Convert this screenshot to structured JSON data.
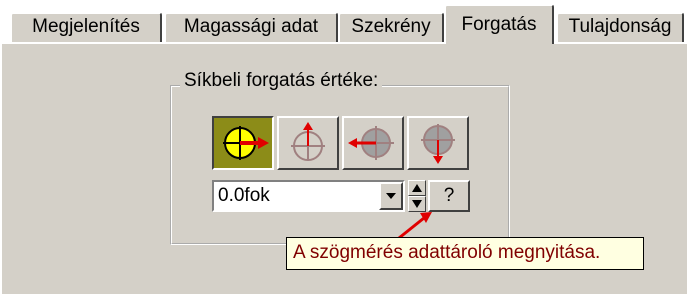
{
  "tabs": [
    {
      "label": "Megjelenítés",
      "active": false
    },
    {
      "label": "Magassági adat",
      "active": false
    },
    {
      "label": "Szekrény",
      "active": false
    },
    {
      "label": "Forgatás",
      "active": true
    },
    {
      "label": "Tulajdonság",
      "active": false
    }
  ],
  "group": {
    "label": "Síkbeli forgatás értéke:"
  },
  "rotation_buttons": [
    {
      "name": "rotate-right",
      "selected": true
    },
    {
      "name": "rotate-up",
      "selected": false
    },
    {
      "name": "rotate-left",
      "selected": false
    },
    {
      "name": "rotate-down",
      "selected": false
    }
  ],
  "angle_combo": {
    "value": "0.0fok"
  },
  "help_button": {
    "label": "?"
  },
  "tooltip": {
    "text": "A szögmérés adattároló megnyitása."
  },
  "colors": {
    "panel": "#d4d0c8",
    "selected_button": "#8c8c18",
    "arrow_red": "#e00000",
    "tooltip_bg": "#ffffe1",
    "tooltip_text": "#800000"
  }
}
